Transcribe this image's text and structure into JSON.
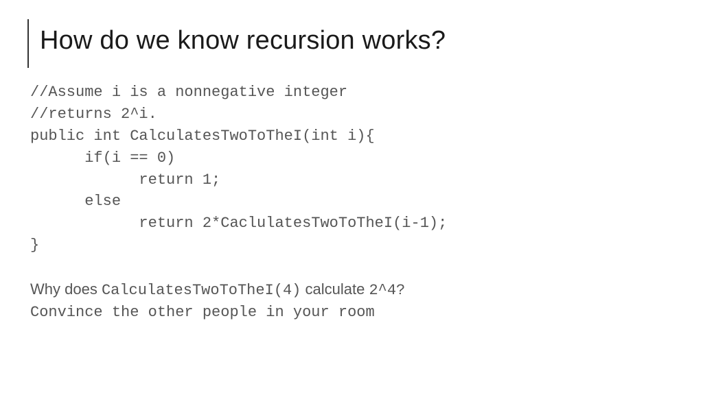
{
  "title": "How do we know recursion works?",
  "code": {
    "comment1": "//Assume i is a nonnegative integer",
    "comment2": "//returns 2^i.",
    "signature": "public int CalculatesTwoToTheI(int i){",
    "if_line": "      if(i == 0)",
    "return1": "            return 1;",
    "else_line": "      else",
    "return2": "            return 2*CaclulatesTwoToTheI(i-1);",
    "close": "}"
  },
  "question": {
    "prefix": "Why does ",
    "call": "CalculatesTwoToTheI(4)",
    "mid": " calculate ",
    "expr": "2^4?",
    "line2": "Convince the other people in your room"
  }
}
